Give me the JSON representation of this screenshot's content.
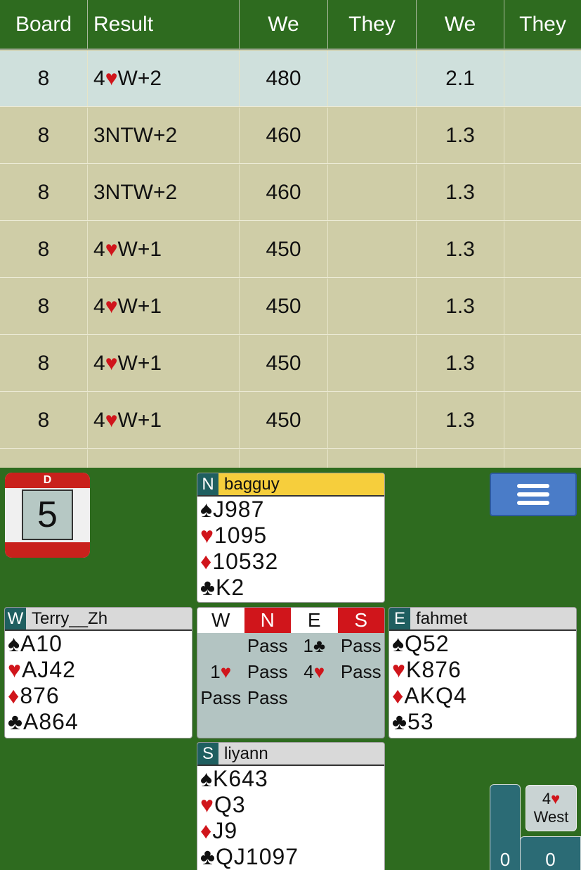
{
  "table": {
    "headers": [
      "Board",
      "Result",
      "We",
      "They",
      "We",
      "They"
    ],
    "rows": [
      {
        "board": "8",
        "level": "4",
        "suit": "♥",
        "rest": "W+2",
        "we1": "480",
        "they1": "",
        "we2": "2.1",
        "they2": ""
      },
      {
        "board": "8",
        "level": "3NTW+2",
        "suit": "",
        "rest": "",
        "we1": "460",
        "they1": "",
        "we2": "1.3",
        "they2": ""
      },
      {
        "board": "8",
        "level": "3NTW+2",
        "suit": "",
        "rest": "",
        "we1": "460",
        "they1": "",
        "we2": "1.3",
        "they2": ""
      },
      {
        "board": "8",
        "level": "4",
        "suit": "♥",
        "rest": "W+1",
        "we1": "450",
        "they1": "",
        "we2": "1.3",
        "they2": ""
      },
      {
        "board": "8",
        "level": "4",
        "suit": "♥",
        "rest": "W+1",
        "we1": "450",
        "they1": "",
        "we2": "1.3",
        "they2": ""
      },
      {
        "board": "8",
        "level": "4",
        "suit": "♥",
        "rest": "W+1",
        "we1": "450",
        "they1": "",
        "we2": "1.3",
        "they2": ""
      },
      {
        "board": "8",
        "level": "4",
        "suit": "♥",
        "rest": "W+1",
        "we1": "450",
        "they1": "",
        "we2": "1.3",
        "they2": ""
      }
    ]
  },
  "board": {
    "dealer": "D",
    "number": "5"
  },
  "hands": {
    "north": {
      "seat": "N",
      "name": "bagguy",
      "spades": "J987",
      "hearts": "1095",
      "diamonds": "10532",
      "clubs": "K2"
    },
    "west": {
      "seat": "W",
      "name": "Terry__Zh",
      "spades": "A10",
      "hearts": "AJ42",
      "diamonds": "876",
      "clubs": "A864"
    },
    "east": {
      "seat": "E",
      "name": "fahmet",
      "spades": "Q52",
      "hearts": "K876",
      "diamonds": "AKQ4",
      "clubs": "53"
    },
    "south": {
      "seat": "S",
      "name": "liyann",
      "spades": "K643",
      "hearts": "Q3",
      "diamonds": "J9",
      "clubs": "QJ1097"
    }
  },
  "suits": {
    "spade": "♠",
    "heart": "♥",
    "diamond": "♦",
    "club": "♣"
  },
  "auction": {
    "header": [
      "W",
      "N",
      "E",
      "S"
    ],
    "rows": [
      [
        "",
        "Pass",
        "1♣",
        "Pass"
      ],
      [
        "1♥",
        "Pass",
        "4♥",
        "Pass"
      ],
      [
        "Pass",
        "Pass",
        "",
        ""
      ]
    ]
  },
  "contract": {
    "level": "4",
    "suit": "♥",
    "declarer": "West"
  },
  "score": {
    "left": "0",
    "right": "0"
  },
  "colors": {
    "felt": "#2e6b1f",
    "vulnerable": "#d0151b",
    "north_bar": "#f6ce3c",
    "menu": "#4a7cc8"
  }
}
